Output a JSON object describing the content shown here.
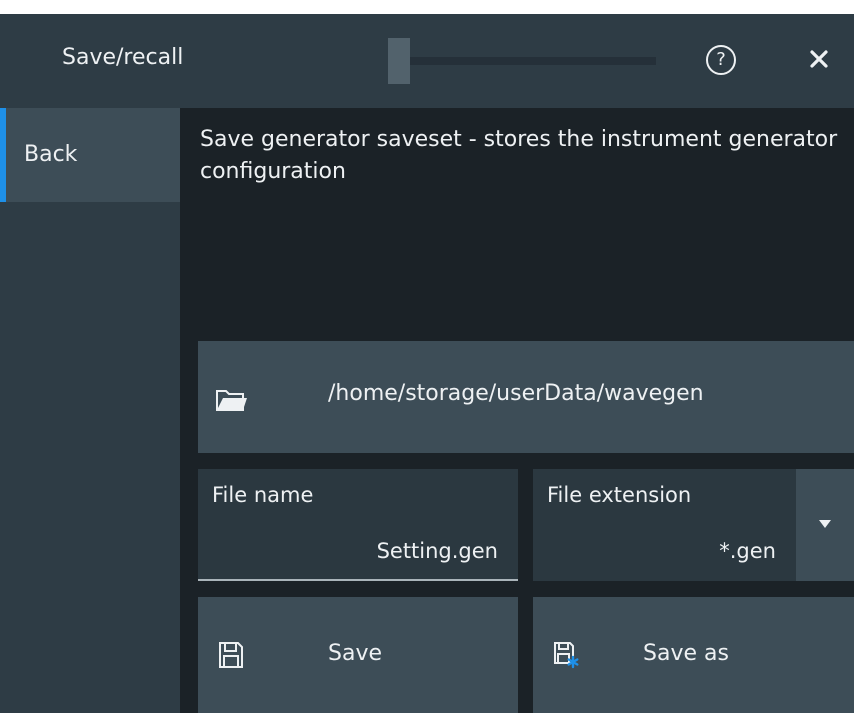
{
  "dialog": {
    "title": "Save/recall",
    "help_symbol": "?",
    "icons": {
      "help": "help-icon",
      "close": "close-icon"
    }
  },
  "sidebar": {
    "items": [
      {
        "label": "Back",
        "active": true
      }
    ]
  },
  "main": {
    "description": "Save generator saveset - stores the instrument generator configuration",
    "path": {
      "icon": "folder-open-icon",
      "value": "/home/storage/userData/wavegen"
    },
    "file_name": {
      "label": "File name",
      "value": "Setting.gen"
    },
    "file_extension": {
      "label": "File extension",
      "value": "*.gen",
      "icon": "chevron-down-icon"
    },
    "buttons": {
      "save": {
        "label": "Save",
        "icon": "save-icon"
      },
      "save_as": {
        "label": "Save as",
        "icon": "save-as-icon"
      }
    }
  },
  "colors": {
    "background": "#1b2227",
    "panel": "#2e3c45",
    "button": "#3d4d57",
    "accent": "#1e90e8"
  }
}
